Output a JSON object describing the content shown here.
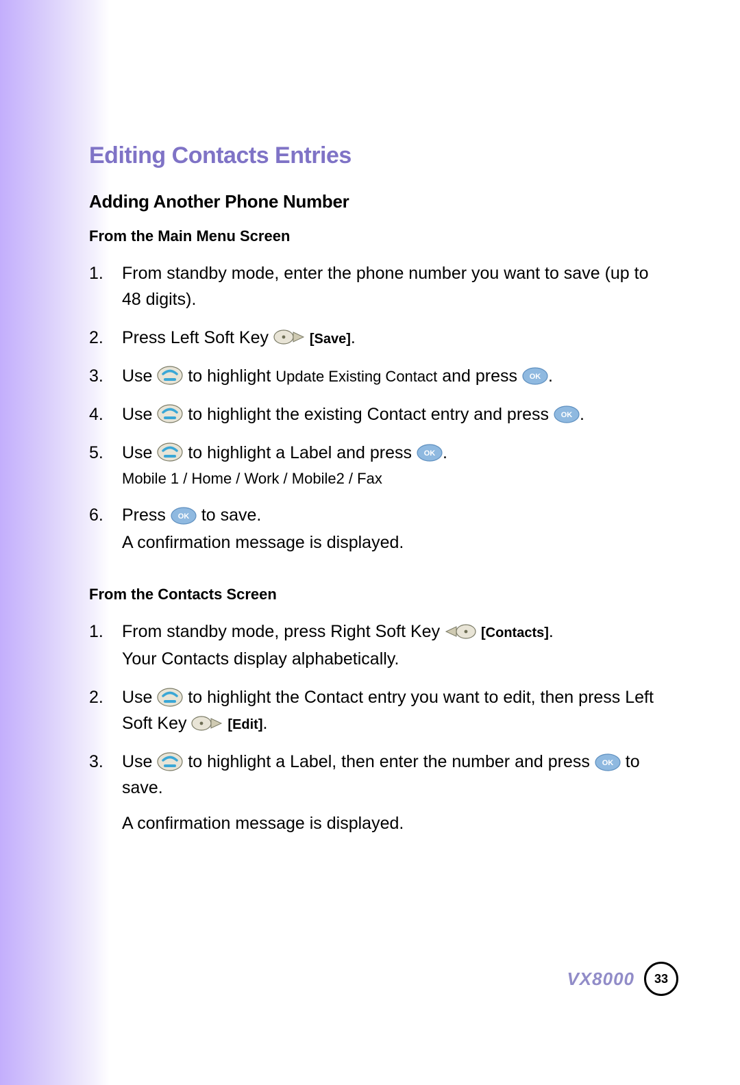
{
  "title": "Editing Contacts Entries",
  "subhead": "Adding Another Phone Number",
  "sectionA": {
    "heading": "From the Main Menu Screen",
    "steps": [
      {
        "num": "1.",
        "text_a": "From standby mode, enter the phone number you want to save (up to 48 digits)."
      },
      {
        "num": "2.",
        "text_a": "Press Left Soft Key ",
        "key_label": "[Save]",
        "text_b": "."
      },
      {
        "num": "3.",
        "text_a": "Use ",
        "text_b": " to highlight ",
        "menu": "Update Existing Contact",
        "text_c": " and press ",
        "text_d": "."
      },
      {
        "num": "4.",
        "text_a": "Use ",
        "text_b": " to highlight the existing Contact entry and press ",
        "text_c": "."
      },
      {
        "num": "5.",
        "text_a": "Use ",
        "text_b": " to highlight a Label and press ",
        "text_c": ".",
        "sub": "Mobile 1 / Home / Work / Mobile2 / Fax"
      },
      {
        "num": "6.",
        "text_a": "Press ",
        "text_b": " to save.",
        "sub": "A confirmation message is displayed."
      }
    ]
  },
  "sectionB": {
    "heading": "From the Contacts Screen",
    "steps": [
      {
        "num": "1.",
        "text_a": "From standby mode, press Right Soft Key ",
        "key_label": "[Contacts]",
        "text_b": ".",
        "sub": "Your Contacts display alphabetically."
      },
      {
        "num": "2.",
        "text_a": "Use ",
        "text_b": " to highlight the Contact entry you want to edit, then press Left Soft Key ",
        "key_label": "[Edit]",
        "text_c": "."
      },
      {
        "num": "3.",
        "text_a": "Use ",
        "text_b": " to highlight a Label, then enter the number and press ",
        "text_c": " to save.",
        "sub": "A confirmation message is displayed."
      }
    ]
  },
  "footer": {
    "model": "VX8000",
    "page": "33"
  },
  "icons": {
    "ok": "OK"
  }
}
